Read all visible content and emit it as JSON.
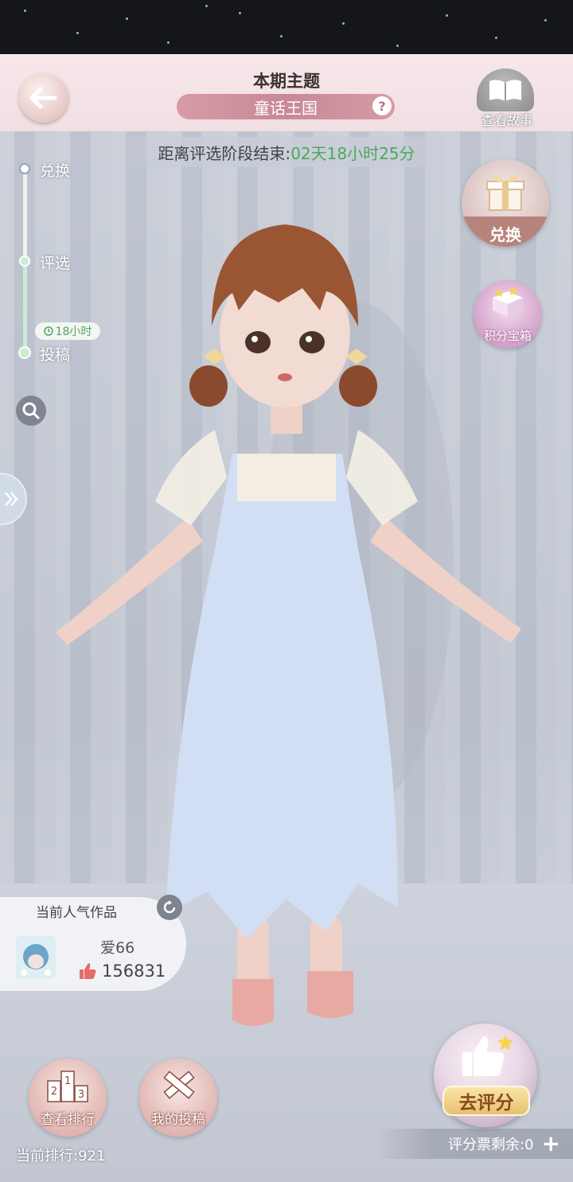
{
  "header": {
    "theme_label": "本期主题",
    "theme_name": "童话王国",
    "help_glyph": "?",
    "story_label": "查看故事"
  },
  "countdown": {
    "label": "距离评选阶段结束:",
    "time": "02天18小时25分"
  },
  "stages": {
    "items": [
      {
        "label": "兑换"
      },
      {
        "label": "评选"
      },
      {
        "label": "投稿"
      }
    ],
    "timer": "18小时"
  },
  "right_buttons": {
    "exchange_label": "兑换",
    "chest_label": "积分宝箱"
  },
  "popular": {
    "title": "当前人气作品",
    "name": "爱66",
    "likes": "156831"
  },
  "bottom": {
    "rank_label": "查看排行",
    "submission_label": "我的投稿",
    "current_rank": "当前排行:921",
    "rate_label": "去评分",
    "tickets": "评分票剩余:0",
    "plus": "+"
  },
  "icons": {
    "back": "back-arrow-icon",
    "story": "open-book-icon",
    "zoom": "magnifier-icon",
    "side_tab": "double-chevron-right-icon",
    "exchange": "gift-box-icon",
    "chest": "treasure-chest-icon",
    "refresh": "refresh-icon",
    "like": "thumbs-up-icon",
    "rank": "podium-icon",
    "submission": "pencil-ruler-icon",
    "rate": "thumbs-up-star-icon"
  },
  "colors": {
    "timer_green": "#4fa75d",
    "theme_pill": "#c98897",
    "like_red": "#e56a6a"
  }
}
